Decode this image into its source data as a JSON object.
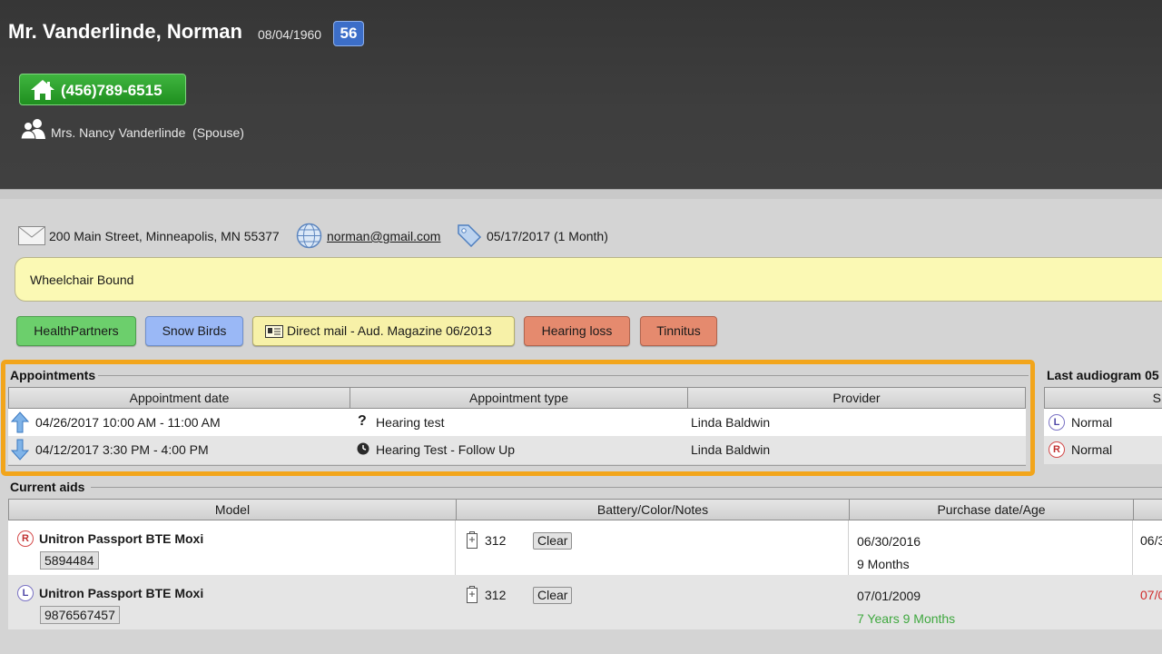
{
  "patient": {
    "name": "Mr. Vanderlinde, Norman",
    "dob": "08/04/1960",
    "age": "56",
    "phone": "(456)789-6515",
    "contact": "Mrs. Nancy Vanderlinde  (Spouse)",
    "address": "200 Main Street, Minneapolis, MN 55377",
    "email": "norman@gmail.com",
    "tag_date": "05/17/2017 (1 Month)",
    "alert": "Wheelchair Bound"
  },
  "tags": [
    {
      "label": "HealthPartners",
      "color": "#6ccf6c"
    },
    {
      "label": "Snow Birds",
      "color": "#9ab8f6"
    },
    {
      "label": "Direct mail - Aud. Magazine 06/2013",
      "color": "#f7f1a8"
    },
    {
      "label": "Hearing loss",
      "color": "#e58a6e"
    },
    {
      "label": "Tinnitus",
      "color": "#e58a6e"
    }
  ],
  "appointments": {
    "title": "Appointments",
    "columns": [
      "Appointment date",
      "Appointment type",
      "Provider"
    ],
    "rows": [
      {
        "date": "04/26/2017  10:00 AM - 11:00 AM",
        "type": "Hearing test",
        "provider": "Linda Baldwin",
        "direction_icon": "arrow-up-icon",
        "type_icon": "question-mark-icon"
      },
      {
        "date": "04/12/2017  3:30 PM - 4:00 PM",
        "type": "Hearing Test - Follow Up",
        "provider": "Linda Baldwin",
        "direction_icon": "arrow-down-icon",
        "type_icon": "clock-icon"
      }
    ]
  },
  "audiogram": {
    "title": "Last audiogram 05",
    "column": "S",
    "rows": [
      {
        "side": "L",
        "value": "Normal"
      },
      {
        "side": "R",
        "value": "Normal"
      }
    ]
  },
  "current_aids": {
    "title": "Current aids",
    "columns": [
      "Model",
      "Battery/Color/Notes",
      "Purchase date/Age",
      ""
    ],
    "rows": [
      {
        "side": "R",
        "model": "Unitron Passport BTE Moxi",
        "serial": "5894484",
        "battery": "312",
        "clear_label": "Clear",
        "purchase_date": "06/30/2016",
        "age": "9 Months",
        "extra": "06/3"
      },
      {
        "side": "L",
        "model": "Unitron Passport BTE Moxi",
        "serial": "9876567457",
        "battery": "312",
        "clear_label": "Clear",
        "purchase_date": "07/01/2009",
        "age": "7 Years 9 Months",
        "extra": "07/0"
      }
    ]
  },
  "colors": {
    "header_bg": "#3a3a3a",
    "phone_green": "#2ea02e",
    "highlight_orange": "#f2a51b",
    "age_badge_blue": "#3c6ec8",
    "old_age_green": "#3fa83f",
    "warranty_red": "#d02a2a"
  },
  "icons": {
    "phone": "house-icon",
    "contact": "people-icon",
    "address": "envelope-icon",
    "email": "globe-icon",
    "tag": "tag-icon",
    "battery": "battery-icon"
  }
}
